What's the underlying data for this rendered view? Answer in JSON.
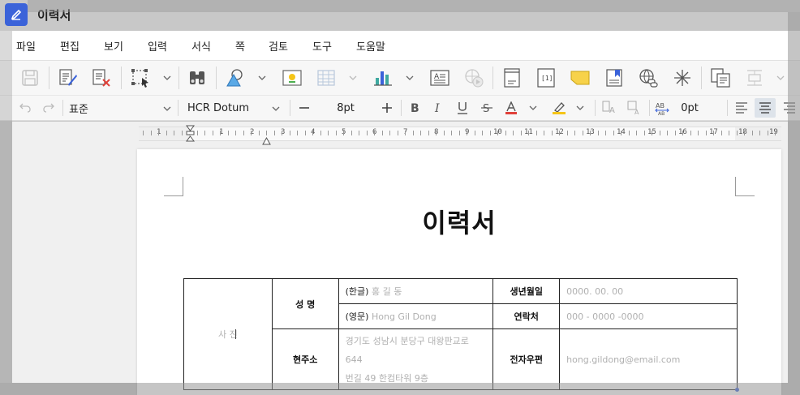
{
  "window": {
    "title": "이력서"
  },
  "menu": [
    "파일",
    "편집",
    "보기",
    "입력",
    "서식",
    "쪽",
    "검토",
    "도구",
    "도움말"
  ],
  "toolbar1": {
    "icons": [
      "save-icon",
      "edit-document-icon",
      "delete-document-icon",
      "select-object-icon",
      "find-icon",
      "shapes-icon",
      "picture-icon",
      "table-icon",
      "chart-icon",
      "text-box-icon",
      "media-icon",
      "header-footer-icon",
      "page-number-icon",
      "memo-icon",
      "bookmark-icon",
      "hyperlink-icon",
      "special-char-icon",
      "copy-format-icon",
      "paste-format-icon"
    ]
  },
  "toolbar2": {
    "style": "표준",
    "font": "HCR Dotum",
    "size": "8pt",
    "spacing": "0pt"
  },
  "ruler": [
    "1",
    "1",
    "2",
    "3",
    "4",
    "5",
    "6",
    "7",
    "8",
    "9",
    "10",
    "11",
    "12",
    "13",
    "14",
    "15",
    "16",
    "17",
    "18",
    "19"
  ],
  "document": {
    "heading": "이력서",
    "photo": "사 진",
    "name_label": "성 명",
    "name_kr_label": "(한글)",
    "name_kr": "홍 길 동",
    "name_en_label": "(영문)",
    "name_en": "Hong Gil Dong",
    "birth_label": "생년월일",
    "birth": "0000. 00. 00",
    "phone_label": "연락처",
    "phone": "000 - 0000 -0000",
    "address_label": "현주소",
    "address_line1": "경기도 성남시 분당구 대왕판교로 644",
    "address_line2": "번길 49 한컴타워 9층",
    "email_label": "전자우편",
    "email": "hong.gildong@email.com"
  }
}
